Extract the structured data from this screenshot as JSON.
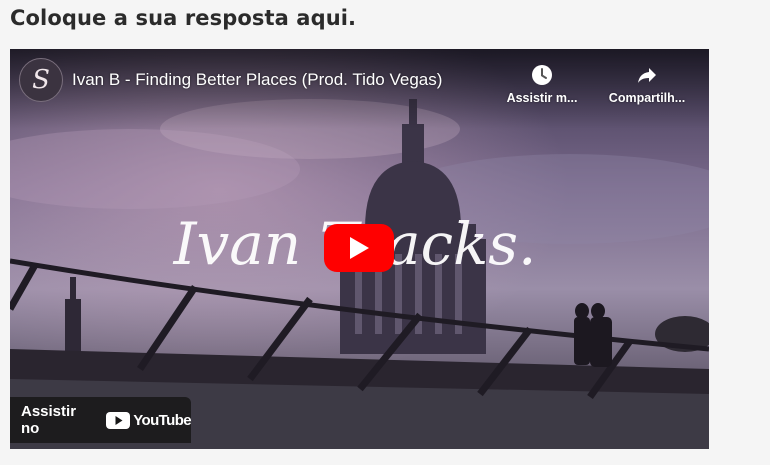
{
  "page": {
    "heading": "Coloque a sua resposta aqui."
  },
  "video": {
    "channel_avatar_letter": "S",
    "title": "Ivan B - Finding Better Places (Prod. Tido Vegas)",
    "watch_later_label": "Assistir m...",
    "share_label": "Compartilh...",
    "watch_on_label": "Assistir no",
    "youtube_wordmark": "YouTube",
    "thumbnail_overlay_text": "Ivan Tracks.",
    "play_color": "#ff0000"
  }
}
